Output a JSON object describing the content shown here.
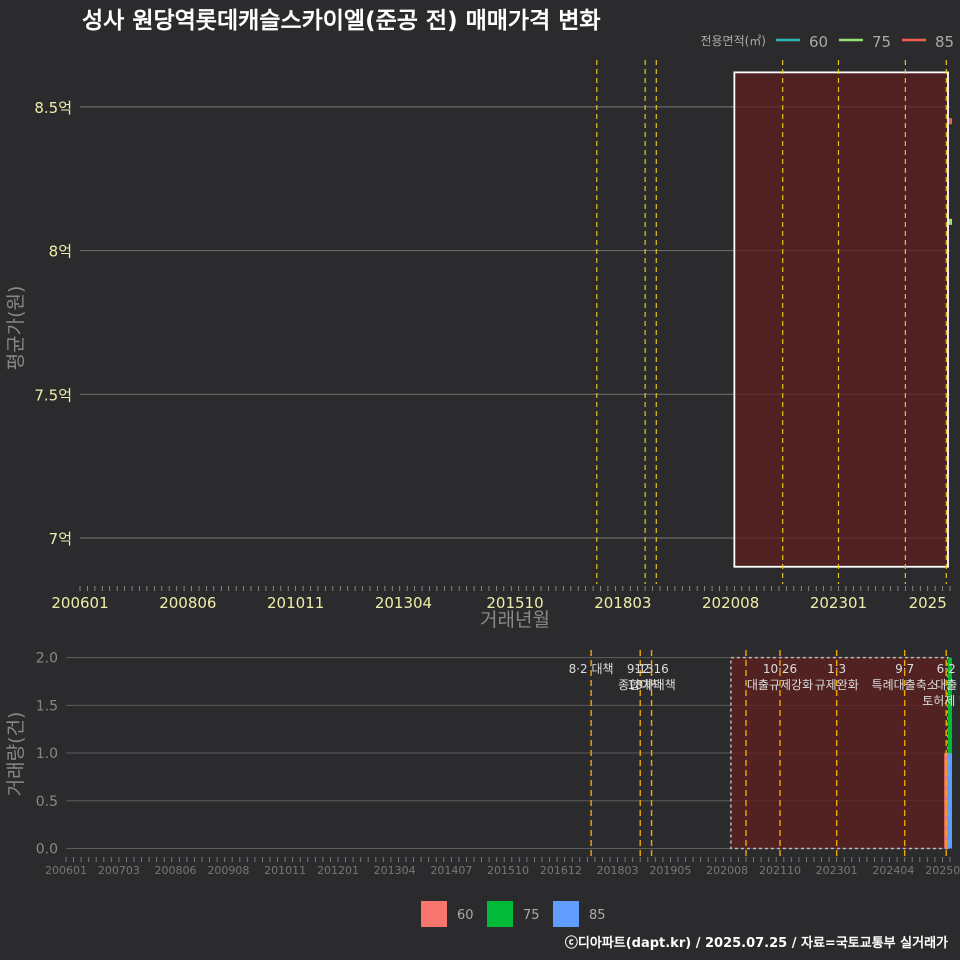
{
  "title": "성사 원당역롯데캐슬스카이엘(준공 전) 매매가격 변화",
  "credit": "ⓒ디아파트(dapt.kr) / 2025.07.25 / 자료=국토교통부 실거래가",
  "colors": {
    "background": "#2b2b2d",
    "s60_line": "#2bb5b5",
    "s75_line": "#98e070",
    "s85_line": "#f06050",
    "s60_bar": "#f8766d",
    "s75_bar": "#00ba38",
    "s85_bar": "#619cff",
    "policy_top": "#e6c619",
    "policy_bottom": "#f0a800",
    "highlight_fill": "#5c1f1f",
    "axis_text": "#eeeeaa",
    "muted_text": "#888888"
  },
  "chart_data": [
    {
      "type": "line",
      "panel": "price",
      "xlabel": "거래년월",
      "ylabel": "평균가(원)",
      "x_ticks": [
        "200601",
        "200806",
        "201011",
        "201304",
        "201510",
        "201803",
        "202008",
        "202301",
        "2025"
      ],
      "x_range": [
        "200601",
        "202507"
      ],
      "y_ticks": [
        "7억",
        "7.5억",
        "8억",
        "8.5억"
      ],
      "y_tick_values": [
        700000000,
        750000000,
        800000000,
        850000000
      ],
      "ylim": [
        684000000,
        867000000
      ],
      "grid": true,
      "legend_title": "전용면적(㎡)",
      "legend_position": "top-right",
      "series": [
        {
          "name": "60",
          "points": []
        },
        {
          "name": "75",
          "points": [
            {
              "x": "202507",
              "y": 810000000
            }
          ]
        },
        {
          "name": "85",
          "points": [
            {
              "x": "202507",
              "y": 845000000
            }
          ]
        }
      ],
      "policy_lines": [
        "201708",
        "201809",
        "201812",
        "202110",
        "202301",
        "202407",
        "202506"
      ],
      "highlight_range": {
        "from": "202101",
        "to": "202507",
        "y_from": 690000000,
        "y_to": 862000000
      }
    },
    {
      "type": "bar",
      "panel": "volume",
      "ylabel": "거래량(건)",
      "x_ticks": [
        "200601",
        "200703",
        "200806",
        "200908",
        "201011",
        "201201",
        "201304",
        "201407",
        "201510",
        "201612",
        "201803",
        "201905",
        "202008",
        "202110",
        "202301",
        "202404",
        "202506"
      ],
      "y_ticks": [
        "0.0",
        "0.5",
        "1.0",
        "1.5",
        "2.0"
      ],
      "ylim": [
        -0.1,
        2.08
      ],
      "grid": true,
      "legend": [
        "60",
        "75",
        "85"
      ],
      "legend_position": "bottom",
      "series": [
        {
          "name": "60",
          "points": [
            {
              "x": "202506",
              "y": 1
            }
          ]
        },
        {
          "name": "75",
          "points": [
            {
              "x": "202507",
              "y": 2
            }
          ]
        },
        {
          "name": "85",
          "points": [
            {
              "x": "202507",
              "y": 1
            }
          ]
        }
      ],
      "policies": [
        {
          "date": "201708",
          "labels": [
            "8·2 대책"
          ]
        },
        {
          "date": "201809",
          "labels": [
            "9·13",
            "종합대책"
          ]
        },
        {
          "date": "201812",
          "labels": [
            "12·16",
            "18차대책"
          ]
        },
        {
          "date": "202101",
          "labels": []
        },
        {
          "date": "202110",
          "labels": [
            "10·26",
            "대출규제강화"
          ]
        },
        {
          "date": "202301",
          "labels": [
            "1·3",
            "규제완화"
          ]
        },
        {
          "date": "202407",
          "labels": [
            "9·7",
            "특례대출축소"
          ]
        },
        {
          "date": "202506",
          "labels": [
            "6·2",
            "대출",
            "토허제 해"
          ]
        }
      ],
      "highlight_range": {
        "from": "202101",
        "to": "202507"
      }
    }
  ]
}
